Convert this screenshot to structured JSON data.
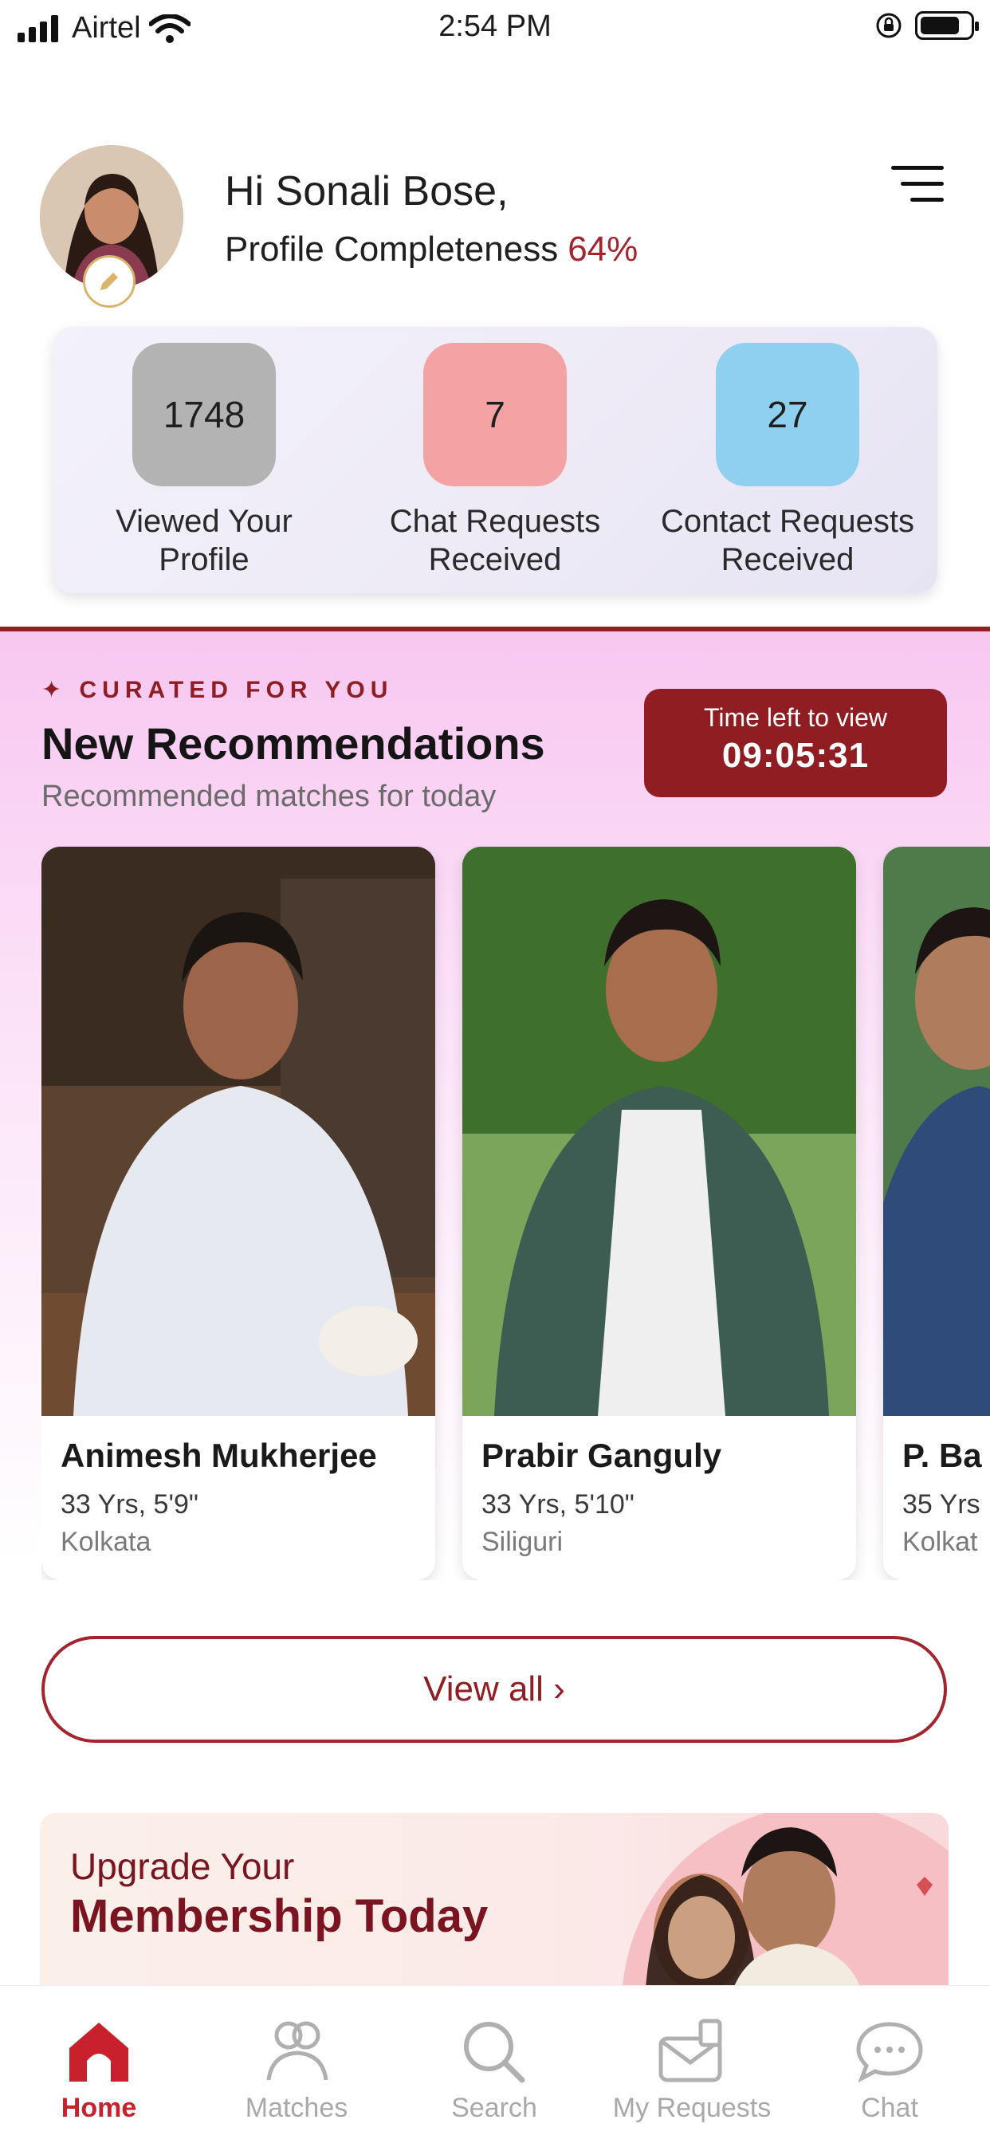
{
  "status_bar": {
    "carrier": "Airtel",
    "time": "2:54 PM"
  },
  "header": {
    "greeting": "Hi Sonali Bose,",
    "completeness_label": "Profile Completeness",
    "completeness_value": "64%"
  },
  "stats": [
    {
      "value": "1748",
      "label": "Viewed Your Profile",
      "color": "#b3b3b3"
    },
    {
      "value": "7",
      "label": "Chat Requests Received",
      "color": "#f4a3a5"
    },
    {
      "value": "27",
      "label": "Contact Requests Received",
      "color": "#8fcff0"
    }
  ],
  "curated": {
    "eyebrow": "CURATED FOR YOU",
    "title": "New Recommendations",
    "subtitle": "Recommended matches for today",
    "timer_label": "Time left to view",
    "timer_value": "09:05:31",
    "view_all": "View all ›"
  },
  "profiles": [
    {
      "name": "Animesh Mukherjee",
      "meta": "33 Yrs, 5'9\"",
      "city": "Kolkata"
    },
    {
      "name": "Prabir Ganguly",
      "meta": "33 Yrs, 5'10\"",
      "city": "Siliguri"
    },
    {
      "name": "P. Ba",
      "meta": "35 Yrs",
      "city": "Kolkat"
    }
  ],
  "banner": {
    "line1": "Upgrade Your",
    "line2": "Membership Today"
  },
  "nav": [
    {
      "label": "Home",
      "icon": "home-icon",
      "active": true
    },
    {
      "label": "Matches",
      "icon": "matches-icon",
      "active": false
    },
    {
      "label": "Search",
      "icon": "search-icon",
      "active": false
    },
    {
      "label": "My Requests",
      "icon": "requests-icon",
      "active": false
    },
    {
      "label": "Chat",
      "icon": "chat-icon",
      "active": false
    }
  ]
}
